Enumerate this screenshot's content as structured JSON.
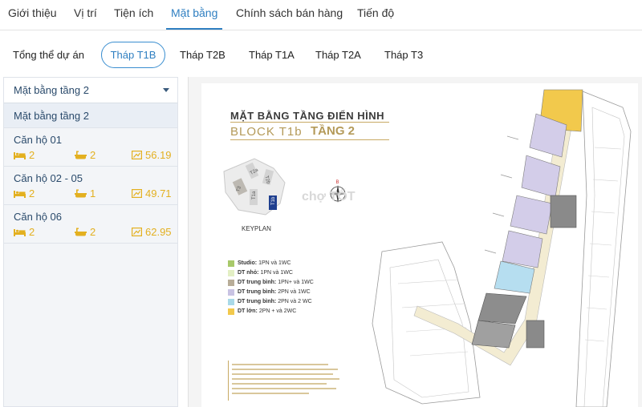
{
  "topnav": {
    "tabs": [
      {
        "label": "Giới thiệu"
      },
      {
        "label": "Vị trí"
      },
      {
        "label": "Tiện ích"
      },
      {
        "label": "Mặt bằng"
      },
      {
        "label": "Chính sách bán hàng"
      },
      {
        "label": "Tiến độ"
      }
    ],
    "active_index": 3,
    "accent_color": "#2f7fc1"
  },
  "towers": {
    "tabs": [
      {
        "label": "Tổng thể dự án"
      },
      {
        "label": "Tháp T1B"
      },
      {
        "label": "Tháp T2B"
      },
      {
        "label": "Tháp T1A"
      },
      {
        "label": "Tháp T2A"
      },
      {
        "label": "Tháp T3"
      }
    ],
    "selected": "Tháp T1B"
  },
  "sidebar": {
    "dropdown_value": "Mặt bằng tầng 2",
    "floor_header": "Mặt bằng tầng 2",
    "units": [
      {
        "name": "Căn hộ 01",
        "bedrooms": "2",
        "bathrooms": "2",
        "area": "56.19"
      },
      {
        "name": "Căn hộ 02 - 05",
        "bedrooms": "2",
        "bathrooms": "1",
        "area": "49.71"
      },
      {
        "name": "Căn hộ 06",
        "bedrooms": "2",
        "bathrooms": "2",
        "area": "62.95"
      }
    ],
    "stat_color": "#e3b020"
  },
  "plan": {
    "title": "MẶT BẰNG TẦNG ĐIỂN HÌNH",
    "block": "BLOCK T1b",
    "floor": "TẦNG 2",
    "keyplan_label": "KEYPLAN",
    "keyplan_towers": [
      "T3",
      "T2a",
      "T2b",
      "T1a",
      "T1b"
    ],
    "compass_label": "B",
    "legend": [
      {
        "name": "Studio:",
        "desc": "1PN và 1WC",
        "color": "#a8c96a"
      },
      {
        "name": "DT nhỏ:",
        "desc": "1PN và 1WC",
        "color": "#e3efc4"
      },
      {
        "name": "DT trung bình:",
        "desc": "1PN+ và 1WC",
        "color": "#b8ad98"
      },
      {
        "name": "DT trung bình:",
        "desc": "2PN và 1WC",
        "color": "#c9c3e3"
      },
      {
        "name": "DT trung bình:",
        "desc": "2PN và 2 WC",
        "color": "#a9d9e8"
      },
      {
        "name": "DT lớn:",
        "desc": "2PN + và 2WC",
        "color": "#f2c94c"
      }
    ],
    "watermark": "chợ TỐT"
  }
}
